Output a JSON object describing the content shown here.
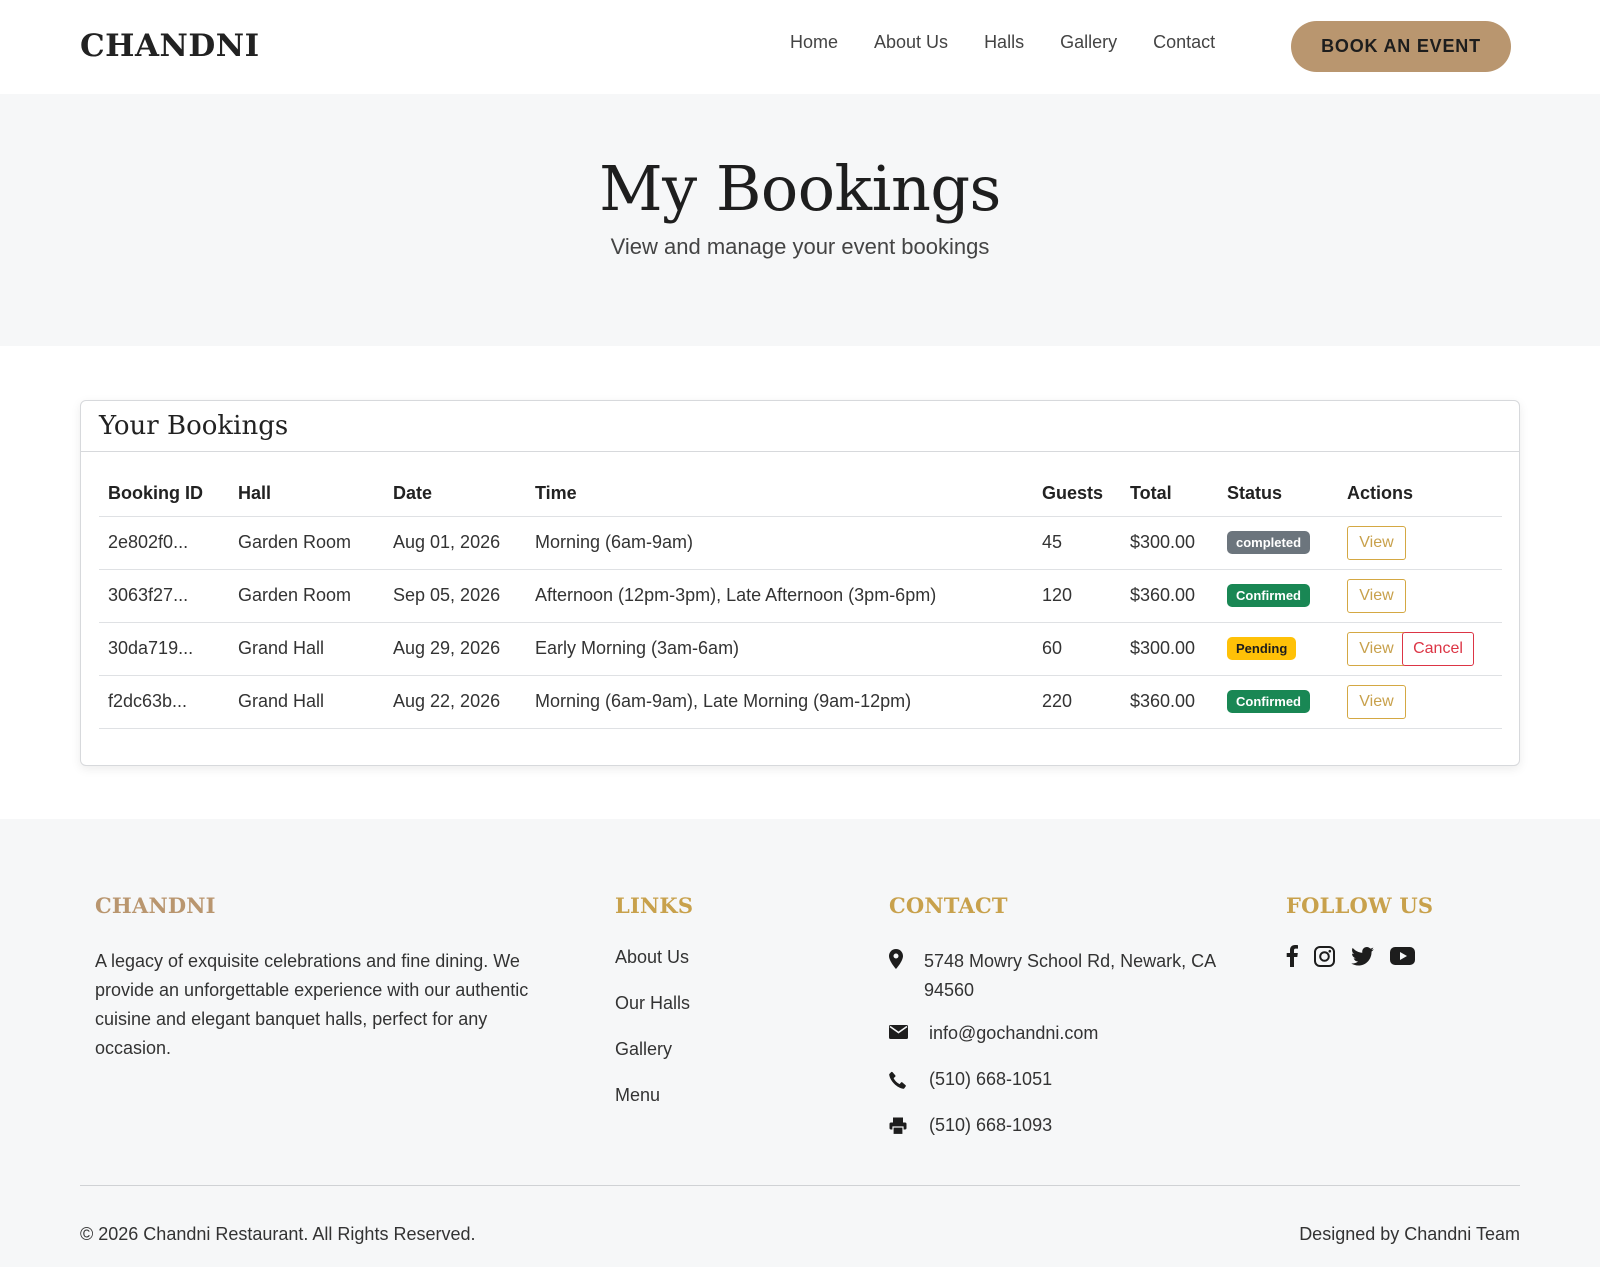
{
  "header": {
    "brand": "CHANDNI",
    "nav": [
      "Home",
      "About Us",
      "Halls",
      "Gallery",
      "Contact"
    ],
    "cta_label": "BOOK AN EVENT"
  },
  "hero": {
    "title": "My Bookings",
    "subtitle": "View and manage your event bookings"
  },
  "bookings": {
    "card_title": "Your Bookings",
    "columns": [
      "Booking ID",
      "Hall",
      "Date",
      "Time",
      "Guests",
      "Total",
      "Status",
      "Actions"
    ],
    "rows": [
      {
        "id": "2e802f0...",
        "hall": "Garden Room",
        "date": "Aug 01, 2026",
        "time": "Morning (6am-9am)",
        "guests": "45",
        "total": "$300.00",
        "status": "completed",
        "actions": [
          "View"
        ]
      },
      {
        "id": "3063f27...",
        "hall": "Garden Room",
        "date": "Sep 05, 2026",
        "time": "Afternoon (12pm-3pm), Late Afternoon (3pm-6pm)",
        "guests": "120",
        "total": "$360.00",
        "status": "Confirmed",
        "actions": [
          "View"
        ]
      },
      {
        "id": "30da719...",
        "hall": "Grand Hall",
        "date": "Aug 29, 2026",
        "time": "Early Morning (3am-6am)",
        "guests": "60",
        "total": "$300.00",
        "status": "Pending",
        "actions": [
          "View",
          "Cancel"
        ]
      },
      {
        "id": "f2dc63b...",
        "hall": "Grand Hall",
        "date": "Aug 22, 2026",
        "time": "Morning (6am-9am), Late Morning (9am-12pm)",
        "guests": "220",
        "total": "$360.00",
        "status": "Confirmed",
        "actions": [
          "View"
        ]
      }
    ],
    "status_colors": {
      "completed": "#6c757d",
      "Confirmed": "#198754",
      "Pending": "#ffc107"
    }
  },
  "footer": {
    "brand": {
      "heading": "CHANDNI",
      "text": "A legacy of exquisite celebrations and fine dining. We provide an unforgettable experience with our authentic cuisine and elegant banquet halls, perfect for any occasion."
    },
    "links": {
      "heading": "LINKS",
      "items": [
        "About Us",
        "Our Halls",
        "Gallery",
        "Menu"
      ]
    },
    "contact": {
      "heading": "CONTACT",
      "address": "5748 Mowry School Rd, Newark, CA 94560",
      "email": "info@gochandni.com",
      "phone": "(510) 668-1051",
      "fax": "(510) 668-1093"
    },
    "follow": {
      "heading": "FOLLOW US",
      "icons": [
        "facebook-icon",
        "instagram-icon",
        "twitter-icon",
        "youtube-icon"
      ]
    },
    "copyright": "© 2026 Chandni Restaurant. All Rights Reserved.",
    "designed_by": "Designed by Chandni Team"
  },
  "colors": {
    "accent": "#b9966f",
    "footer_heading_gold": "#c8a14c",
    "footer_heading_brand": "#b9966f"
  }
}
